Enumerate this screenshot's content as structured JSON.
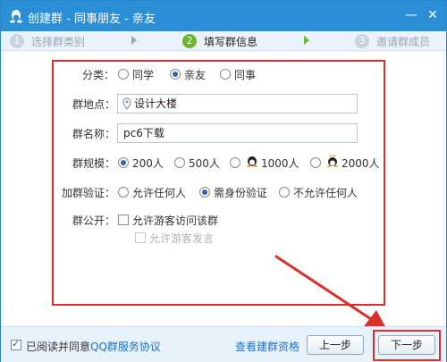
{
  "window": {
    "title": "创建群 - 同事朋友 - 亲友",
    "minimize_glyph": "—",
    "close_glyph": "✕"
  },
  "steps": [
    {
      "num": "1",
      "label": "选择群类别"
    },
    {
      "num": "2",
      "label": "填写群信息"
    },
    {
      "num": "3",
      "label": "邀请群成员"
    }
  ],
  "form": {
    "category": {
      "label": "分类：",
      "options": [
        "同学",
        "亲友",
        "同事"
      ],
      "selected": "亲友"
    },
    "location": {
      "label": "群地点：",
      "value": "设计大楼"
    },
    "name": {
      "label": "群名称：",
      "value": "pc6下载"
    },
    "size": {
      "label": "群规模：",
      "options": [
        "200人",
        "500人",
        "1000人",
        "2000人"
      ],
      "selected": "200人"
    },
    "verify": {
      "label": "加群验证：",
      "options": [
        "允许任何人",
        "需身份验证",
        "不允许任何人"
      ],
      "selected": "需身份验证"
    },
    "public": {
      "label": "群公开：",
      "allow_visit": "允许游客访问该群",
      "allow_post": "允许游客发言"
    }
  },
  "footer": {
    "agree_prefix": "已阅读并同意",
    "agree_link": "QQ群服务协议",
    "view_link": "查看建群资格",
    "prev_button": "上一步",
    "next_button": "下一步"
  },
  "colors": {
    "titlebar": "#2b8fd6",
    "highlight": "#d9302c",
    "active_step": "#6cb52d",
    "link": "#1a73c8"
  }
}
